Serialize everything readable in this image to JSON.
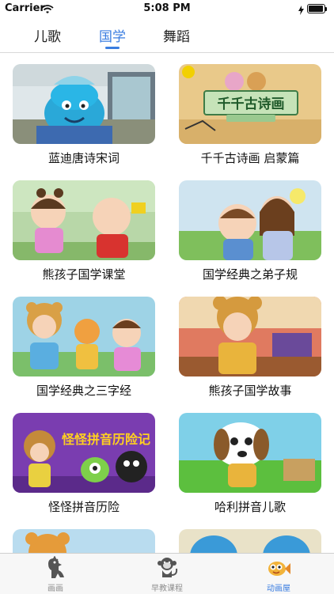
{
  "status": {
    "carrier": "Carrier",
    "time": "5:08 PM"
  },
  "tabs": [
    {
      "label": "儿歌"
    },
    {
      "label": "国学"
    },
    {
      "label": "舞蹈"
    }
  ],
  "active_tab": "国学",
  "cards": [
    {
      "title": "蓝迪唐诗宋词"
    },
    {
      "title": "千千古诗画 启蒙篇",
      "thumb_text": "千千古诗画"
    },
    {
      "title": "熊孩子国学课堂"
    },
    {
      "title": "国学经典之弟子规"
    },
    {
      "title": "国学经典之三字经"
    },
    {
      "title": "熊孩子国学故事"
    },
    {
      "title": "怪怪拼音历险",
      "thumb_text": "怪怪拼音历险记"
    },
    {
      "title": "哈利拼音儿歌"
    }
  ],
  "bottom_nav": [
    {
      "label": "画画",
      "icon": "dinosaur-icon"
    },
    {
      "label": "早教课程",
      "icon": "monkey-icon"
    },
    {
      "label": "动画屋",
      "icon": "fish-icon"
    }
  ],
  "colors": {
    "accent": "#3a7de0",
    "nav_inactive": "#8e8e8e"
  }
}
